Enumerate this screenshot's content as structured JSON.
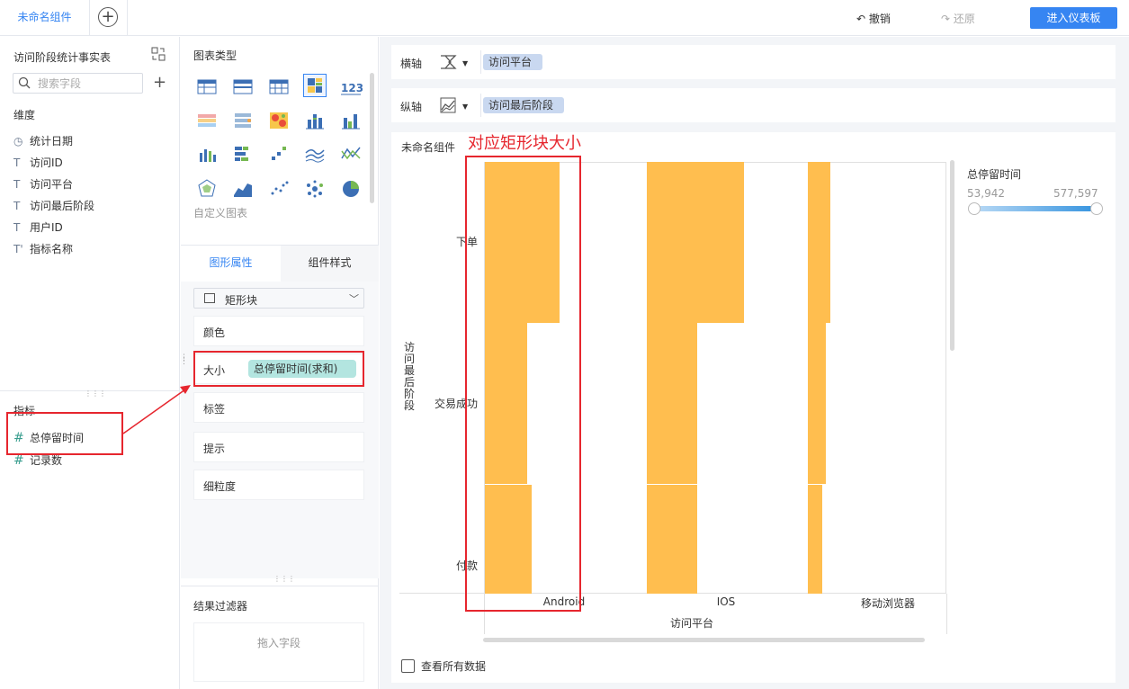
{
  "topbar": {
    "tab_label": "未命名组件",
    "add_tab": "+",
    "undo": "撤销",
    "redo": "还原",
    "enter_dashboard": "进入仪表板"
  },
  "left": {
    "dataset_title": "访问阶段统计事实表",
    "search_placeholder": "搜索字段",
    "add": "+",
    "dimension_title": "维度",
    "dimensions": [
      {
        "icon": "clock-icon",
        "glyph": "◷",
        "label": "统计日期"
      },
      {
        "icon": "text-icon",
        "glyph": "T",
        "label": "访问ID"
      },
      {
        "icon": "text-icon",
        "glyph": "T",
        "label": "访问平台"
      },
      {
        "icon": "text-icon",
        "glyph": "T",
        "label": "访问最后阶段"
      },
      {
        "icon": "text-icon",
        "glyph": "T",
        "label": "用户ID"
      },
      {
        "icon": "text-icon",
        "glyph": "T'",
        "label": "指标名称"
      }
    ],
    "measure_title": "指标",
    "measures": [
      {
        "icon": "hash-icon",
        "glyph": "#",
        "label": "总停留时间"
      },
      {
        "icon": "hash-icon",
        "glyph": "#",
        "label": "记录数"
      }
    ]
  },
  "middle": {
    "chart_type_title": "图表类型",
    "custom_chart": "自定义图表",
    "tab_shape": "图形属性",
    "tab_style": "组件样式",
    "shape": "矩形块",
    "color": "颜色",
    "size": "大小",
    "size_field": "总停留时间(求和)",
    "label": "标签",
    "tooltip": "提示",
    "granularity": "细粒度",
    "filter_title": "结果过滤器",
    "filter_drop": "拖入字段"
  },
  "right": {
    "x_axis_label": "横轴",
    "x_axis_field": "访问平台",
    "y_axis_label": "纵轴",
    "y_axis_field": "访问最后阶段",
    "component_name": "未命名组件",
    "annotation": "对应矩形块大小",
    "view_all": "查看所有数据"
  },
  "colors": {
    "accent": "#3685f2",
    "block": "#ffbe4f",
    "annotation": "#e6262e",
    "size_pill": "#b3e5e0",
    "axis_pill": "#c9d8f0"
  },
  "chart_data": {
    "type": "heatmap",
    "xlabel": "访问平台",
    "ylabel": "访问最后阶段",
    "categories": [
      "Android",
      "IOS",
      "移动浏览器"
    ],
    "y_categories": [
      "下单",
      "交易成功",
      "付款"
    ],
    "size_field": "总停留时间(求和)",
    "values": [
      {
        "x": "Android",
        "y": "下单",
        "size": 0.46
      },
      {
        "x": "Android",
        "y": "交易成功",
        "size": 0.26
      },
      {
        "x": "Android",
        "y": "付款",
        "size": 0.29
      },
      {
        "x": "IOS",
        "y": "下单",
        "size": 0.6
      },
      {
        "x": "IOS",
        "y": "交易成功",
        "size": 0.31
      },
      {
        "x": "IOS",
        "y": "付款",
        "size": 0.31
      },
      {
        "x": "移动浏览器",
        "y": "下单",
        "size": 0.14
      },
      {
        "x": "移动浏览器",
        "y": "交易成功",
        "size": 0.11
      },
      {
        "x": "移动浏览器",
        "y": "付款",
        "size": 0.09
      }
    ],
    "legend": {
      "title": "总停留时间",
      "min": "53,942",
      "max": "577,597"
    }
  }
}
